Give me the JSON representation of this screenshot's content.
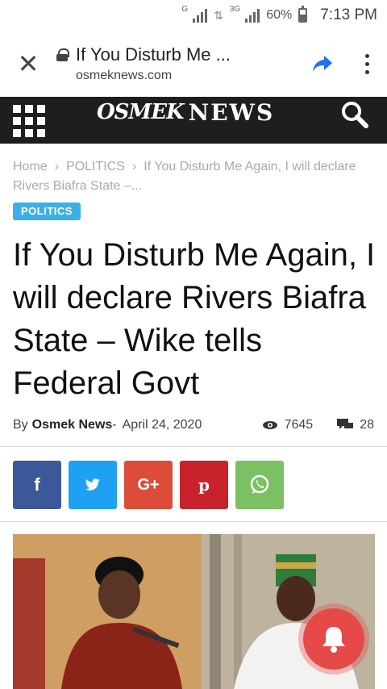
{
  "status_bar": {
    "network_1": "G",
    "network_2": "3G",
    "battery_pct": "60%",
    "time": "7:13 PM"
  },
  "browser": {
    "tab_title": "If You Disturb Me ...",
    "domain": "osmeknews.com"
  },
  "site": {
    "logo_o": "OSMEK",
    "logo_news": "NEWS"
  },
  "breadcrumb": {
    "home": "Home",
    "category": "POLITICS",
    "current": "If You Disturb Me Again, I will declare Rivers Biafra State –..."
  },
  "article": {
    "category_badge": "POLITICS",
    "headline": "If You Disturb Me Again, I will declare Rivers Biafra State – Wike tells Federal Govt",
    "by": "By",
    "author": "Osmek News",
    "date_sep": "-",
    "date": "April 24, 2020",
    "views": "7645",
    "comments": "28"
  },
  "share": [
    {
      "name": "facebook",
      "glyph": "f",
      "color": "#3b5998"
    },
    {
      "name": "twitter",
      "glyph": "t",
      "color": "#1da1f2"
    },
    {
      "name": "google-plus",
      "glyph": "G+",
      "color": "#dd4b39"
    },
    {
      "name": "pinterest",
      "glyph": "p",
      "color": "#c8232c"
    },
    {
      "name": "whatsapp",
      "glyph": "w",
      "color": "#7bc062"
    }
  ]
}
